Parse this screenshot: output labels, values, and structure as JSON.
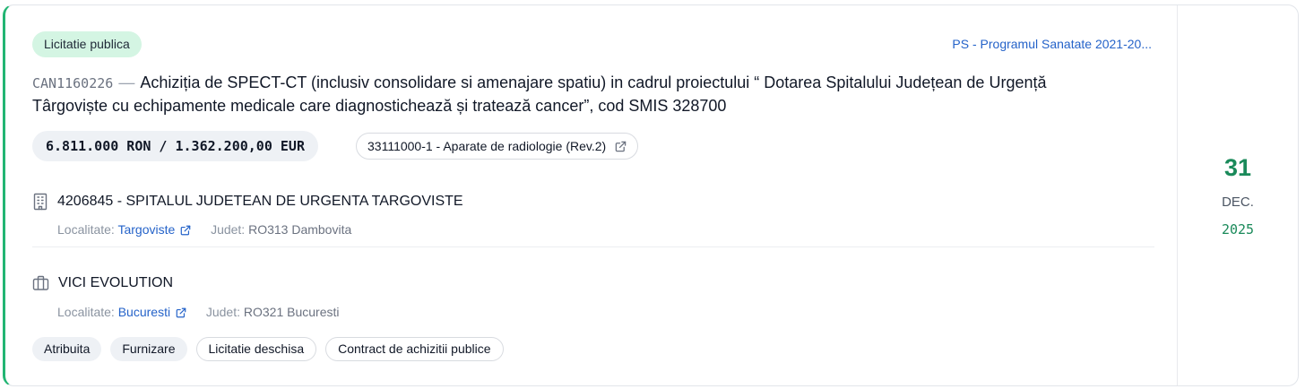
{
  "procedure_type": "Licitatie publica",
  "program": "PS - Programul Sanatate 2021-20...",
  "notice": {
    "code": "CAN1160226",
    "separator": "—",
    "title": "Achiziția de SPECT-CT (inclusiv consolidare si amenajare spatiu) in cadrul proiectului “ Dotarea Spitalului Județean de Urgență Târgoviște cu echipamente medicale care diagnostichează și tratează cancer”, cod SMIS 328700"
  },
  "value": "6.811.000 RON / 1.362.200,00 EUR",
  "cpv": "33111000-1 - Aparate de radiologie (Rev.2)",
  "authority": {
    "name": "4206845 - SPITALUL JUDETEAN DE URGENTA TARGOVISTE",
    "locality_label": "Localitate:",
    "locality": "Targoviste",
    "county_label": "Judet:",
    "county": "RO313 Dambovita",
    "icon": "building-icon"
  },
  "supplier": {
    "name": "VICI EVOLUTION",
    "locality_label": "Localitate:",
    "locality": "Bucuresti",
    "county_label": "Judet:",
    "county": "RO321 Bucuresti",
    "icon": "briefcase-icon"
  },
  "tags": [
    {
      "label": "Atribuita",
      "style": "filled"
    },
    {
      "label": "Furnizare",
      "style": "filled"
    },
    {
      "label": "Licitatie deschisa",
      "style": "outlined"
    },
    {
      "label": "Contract de achizitii publice",
      "style": "outlined"
    }
  ],
  "date": {
    "day": "31",
    "month": "DEC.",
    "year": "2025"
  },
  "colors": {
    "accent": "#22b573",
    "badge_bg": "#d4f5e3",
    "link": "#2563c9",
    "date_green": "#1a8a5a"
  }
}
